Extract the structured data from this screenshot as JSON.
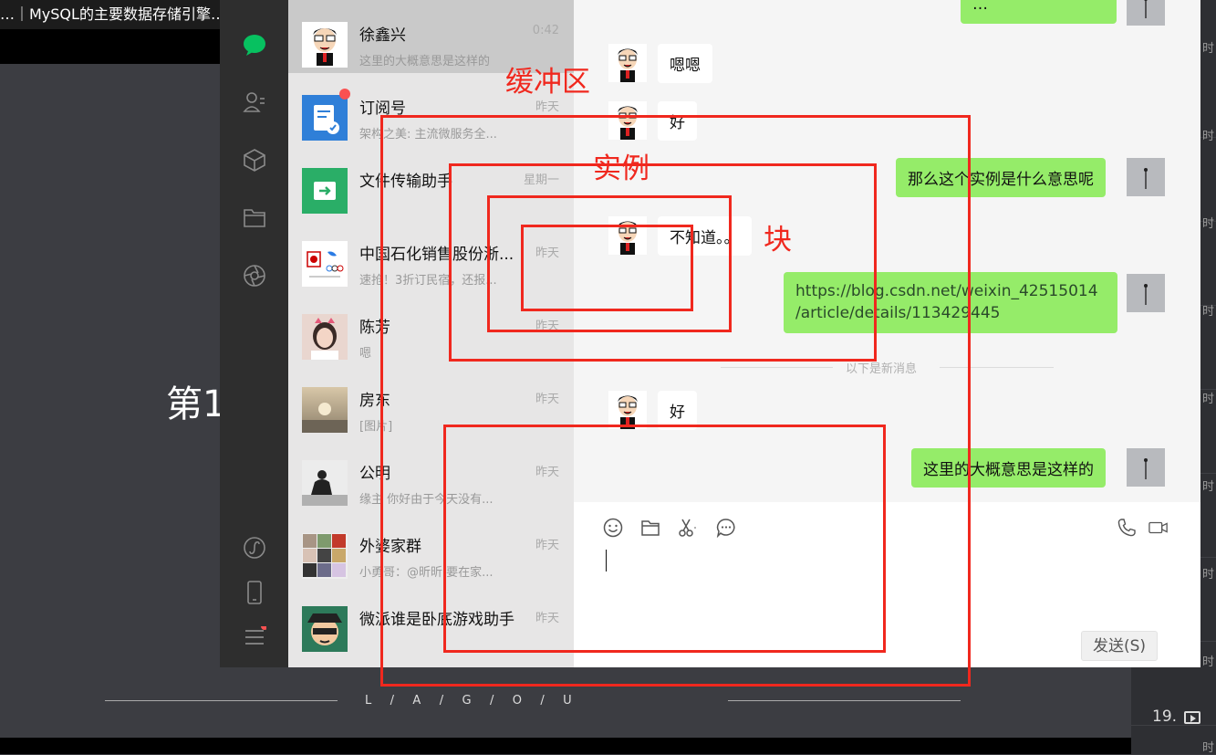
{
  "background": {
    "title": "…｜MySQL的主要数据存储引擎…",
    "big_text": "第1",
    "brand_letters": "L   /   A   /   G   /   O   /   U",
    "playlist": {
      "time_label": "时",
      "item_number": "19."
    }
  },
  "wechat": {
    "conversations": [
      {
        "name": "徐鑫兴",
        "preview": "这里的大概意思是这样的",
        "time": "0:42",
        "avatar": "cartoon-avatar",
        "active": true
      },
      {
        "name": "订阅号",
        "preview": "架构之美: 主流微服务全...",
        "time": "昨天",
        "avatar": "subscription-icon",
        "badge": true
      },
      {
        "name": "文件传输助手",
        "preview": "",
        "time": "星期一",
        "avatar": "file-transfer-icon"
      },
      {
        "name": "中国石化销售股份浙...",
        "preview": "速抢！3折订民宿，还报...",
        "time": "昨天",
        "avatar": "sinopec-avatar"
      },
      {
        "name": "陈芳",
        "preview": "嗯",
        "time": "昨天",
        "avatar": "photo-avatar"
      },
      {
        "name": "房东",
        "preview": "[图片]",
        "time": "昨天",
        "avatar": "sunset-avatar"
      },
      {
        "name": "公明",
        "preview": "缘主 你好由于今天没有...",
        "time": "昨天",
        "avatar": "meditation-avatar"
      },
      {
        "name": "外婆家群",
        "preview": "小勇哥：@昕昕 要在家...",
        "time": "昨天",
        "avatar": "group-avatar"
      },
      {
        "name": "微派谁是卧底游戏助手",
        "preview": "",
        "time": "昨天",
        "avatar": "spy-avatar"
      }
    ],
    "messages": {
      "m1": "嗯嗯",
      "m2": "好",
      "m3": "那么这个实例是什么意思呢",
      "m4": "不知道。。",
      "m5": "https://blog.csdn.net/weixin_42515014\n/article/details/113429445",
      "m6": "好",
      "m7": "这里的大概意思是这样的",
      "m0_partial": "…"
    },
    "divider": "以下是新消息",
    "send_label": "发送(S)",
    "nav_icons": [
      "chat-icon",
      "contacts-icon",
      "box-icon",
      "folder-icon",
      "moments-icon",
      "mini-program-icon",
      "phone-icon",
      "menu-icon"
    ],
    "toolbar_icons": [
      "emoji-icon",
      "folder-icon",
      "scissors-icon",
      "chat-history-icon",
      "voice-call-icon",
      "video-call-icon"
    ]
  },
  "annotations": {
    "buffer_label": "缓冲区",
    "instance_label": "实例",
    "block_label": "块"
  },
  "colors": {
    "annotation_red": "#f0281e",
    "bubble_green": "#95ec69",
    "wechat_green": "#07c160"
  }
}
